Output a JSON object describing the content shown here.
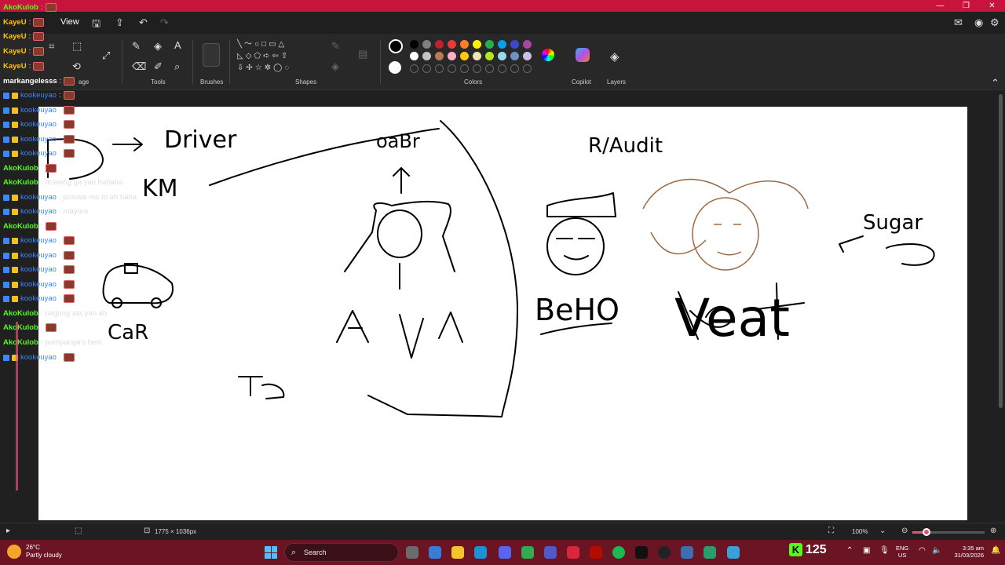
{
  "menubar": {
    "view_label": "View"
  },
  "ribbon": {
    "groups": [
      "age",
      "Tools",
      "Brushes",
      "Shapes",
      "Colors",
      "Copilot",
      "Layers"
    ],
    "palette_row1": [
      "#000000",
      "#7f7f7f",
      "#c0202c",
      "#ec3a3a",
      "#ff7f27",
      "#fff200",
      "#22b14c",
      "#00a2e8",
      "#3f48cc",
      "#a349a4"
    ],
    "palette_row2": [
      "#ffffff",
      "#c3c3c3",
      "#b97a57",
      "#ffaec9",
      "#ffc90e",
      "#efe4b0",
      "#b5e61d",
      "#99d9ea",
      "#7092be",
      "#c8bfe7"
    ]
  },
  "status": {
    "canvas_size": "1775 × 1036px",
    "zoom": "100%",
    "zoom_level_fraction": 0.1
  },
  "canvas_words": {
    "driver": "Driver",
    "km": "KM",
    "car": "CaR",
    "ava": "AVA",
    "beho": "BeHO",
    "veat": "Veat",
    "sugar": "Sugar",
    "audit": "R/Audit",
    "oac": "oaBr"
  },
  "chat": [
    {
      "user": "AkoKulob",
      "color": "green",
      "text": ""
    },
    {
      "user": "KayeU",
      "color": "yellow",
      "text": ""
    },
    {
      "user": "KayeU",
      "color": "yellow",
      "text": ""
    },
    {
      "user": "KayeU",
      "color": "yellow",
      "text": ""
    },
    {
      "user": "KayeU",
      "color": "yellow",
      "text": ""
    },
    {
      "user": "markangelesss",
      "color": "white",
      "text": ""
    },
    {
      "user": "kookeuyao",
      "color": "blue",
      "text": ""
    },
    {
      "user": "kookeuyao",
      "color": "blue",
      "text": ""
    },
    {
      "user": "kookeuyao",
      "color": "blue",
      "text": ""
    },
    {
      "user": "kookeuyao",
      "color": "blue",
      "text": ""
    },
    {
      "user": "kookeuyao",
      "color": "blue",
      "text": ""
    },
    {
      "user": "AkoKulob",
      "color": "green",
      "text": ""
    },
    {
      "user": "AkoKulob",
      "color": "green",
      "text": "drawing ga yan hahaha"
    },
    {
      "user": "kookeuyao",
      "color": "blue",
      "text": "jonvale mo to ah haha"
    },
    {
      "user": "kookeuyao",
      "color": "blue",
      "text": "mayora"
    },
    {
      "user": "AkoKulob",
      "color": "green",
      "text": ""
    },
    {
      "user": "kookeuyao",
      "color": "blue",
      "text": ""
    },
    {
      "user": "kookeuyao",
      "color": "blue",
      "text": ""
    },
    {
      "user": "kookeuyao",
      "color": "blue",
      "text": ""
    },
    {
      "user": "kookeuyao",
      "color": "blue",
      "text": ""
    },
    {
      "user": "kookeuyao",
      "color": "blue",
      "text": ""
    },
    {
      "user": "AkoKulob",
      "color": "green",
      "text": "pagong ata yan ah"
    },
    {
      "user": "AkoKulob",
      "color": "green",
      "text": ""
    },
    {
      "user": "AkoKulob",
      "color": "green",
      "text": "pampanga's best"
    },
    {
      "user": "kookeuyao",
      "color": "blue",
      "text": ""
    }
  ],
  "taskbar": {
    "temperature": "26°C",
    "weather": "Partly cloudy",
    "search_label": "Search",
    "kick_count": "125",
    "lang1": "ENG",
    "lang2": "US",
    "time": "3:35 am",
    "date": "31/03/2026"
  }
}
